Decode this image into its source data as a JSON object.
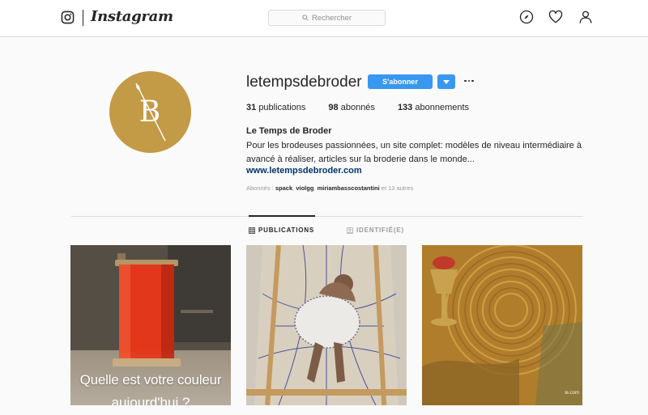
{
  "nav": {
    "wordmark": "Instagram",
    "search_placeholder": "Rechercher",
    "icons": [
      "instagram-glyph-icon",
      "compass-icon",
      "heart-icon",
      "profile-icon"
    ]
  },
  "profile": {
    "username": "letempsdebroder",
    "avatar_letter": "B",
    "follow_label": "S'abonner",
    "full_name": "Le Temps de Broder",
    "bio": "Pour les brodeuses passionnées, un site complet: modèles de niveau intermédiaire à avancé à réaliser, articles sur la broderie dans le monde...",
    "website": "www.letempsdebroder.com",
    "stats": {
      "posts_count": "31",
      "posts_label": "publications",
      "followers_count": "98",
      "followers_label": "abonnés",
      "following_count": "133",
      "following_label": "abonnements"
    },
    "followed_by": {
      "prefix": "Abonnés : ",
      "users": [
        "spack",
        "violgg",
        "miriambasscostantini"
      ],
      "suffix": "et 13 autres"
    }
  },
  "tabs": {
    "posts_label": "PUBLICATIONS",
    "tagged_label": "IDENTIFIÉ(E)"
  },
  "posts": [
    {
      "caption_line1": "Quelle est votre couleur",
      "caption_line2": "aujourd'hui ?"
    },
    {},
    {
      "watermark": "lé.com"
    }
  ],
  "colors": {
    "accent": "#3897f0",
    "avatar_bg": "#c39a45",
    "link": "#003569"
  }
}
